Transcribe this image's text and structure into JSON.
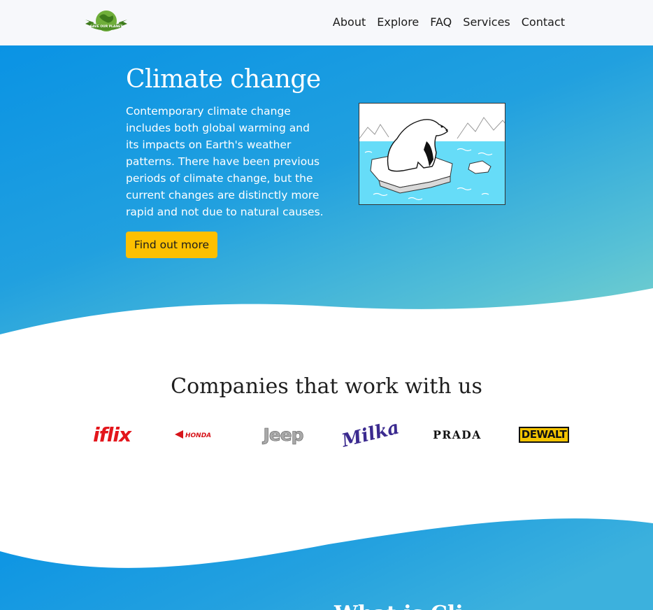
{
  "navbar": {
    "logo_text": "SAVE OUR PLANET",
    "links": [
      "About",
      "Explore",
      "FAQ",
      "Services",
      "Contact"
    ]
  },
  "hero": {
    "title": "Climate change",
    "text": "Contemporary climate change includes both global warming and its impacts on Earth's weather patterns. There have been previous periods of climate change, but the current changes are distinctly more rapid and not due to natural causes.",
    "button_label": "Find out more",
    "illustration_icon": "polar-bear-on-ice-floe"
  },
  "companies": {
    "title": "Companies that work with us",
    "brands": {
      "iflix": "iflix",
      "honda": "HONDA",
      "jeep": "Jeep",
      "milka": "Milka",
      "prada": "PRADA",
      "dewalt": "DEWALT"
    }
  },
  "next_section": {
    "title_partial": "What is Cli"
  },
  "colors": {
    "accent": "#fdc000",
    "hero_gradient_start": "#0a93e4",
    "hero_gradient_end": "#7ad3cb",
    "nav_bg": "#f7f8fb"
  }
}
